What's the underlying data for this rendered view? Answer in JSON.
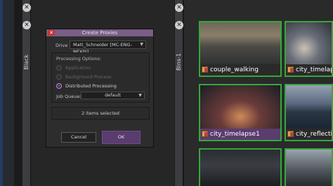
{
  "panels": {
    "black_tab": {
      "label": "Black"
    },
    "bins_tab": {
      "label": "Bins-1"
    },
    "close_glyph": "✕"
  },
  "dialog": {
    "title": "Create Proxies",
    "close_glyph": "✕",
    "drive_label": "Drive",
    "drive_value": "Matt_Schneider [MC-ENG-NEXIS]",
    "processing_title": "Processing Options:",
    "options": [
      {
        "label": "Application",
        "enabled": false,
        "selected": false
      },
      {
        "label": "Background Process",
        "enabled": false,
        "selected": false
      },
      {
        "label": "Distributed Processing",
        "enabled": true,
        "selected": true
      }
    ],
    "job_queue_label": "Job Queue:",
    "job_queue_value": "default",
    "selection_status": "2 items selected",
    "cancel_label": "Cancel",
    "ok_label": "OK",
    "dropdown_glyph": "▼"
  },
  "bin": {
    "clips": [
      {
        "name": "couple_walking",
        "icon": "clip-icon",
        "selected": false
      },
      {
        "name": "city_timelapse",
        "icon": "clip-icon",
        "selected": false
      },
      {
        "name": "city_timelapse1",
        "icon": "clip-icon",
        "selected": true
      },
      {
        "name": "city_reflection",
        "icon": "clip-icon",
        "selected": false
      },
      {
        "name": "",
        "icon": "clip-icon",
        "selected": false
      },
      {
        "name": "",
        "icon": "clip-icon",
        "selected": false
      }
    ]
  },
  "colors": {
    "accent": "#5a3c6e",
    "title_bar": "#7a5e86",
    "tile_border": "#36a83b",
    "close_red": "#c63434"
  }
}
